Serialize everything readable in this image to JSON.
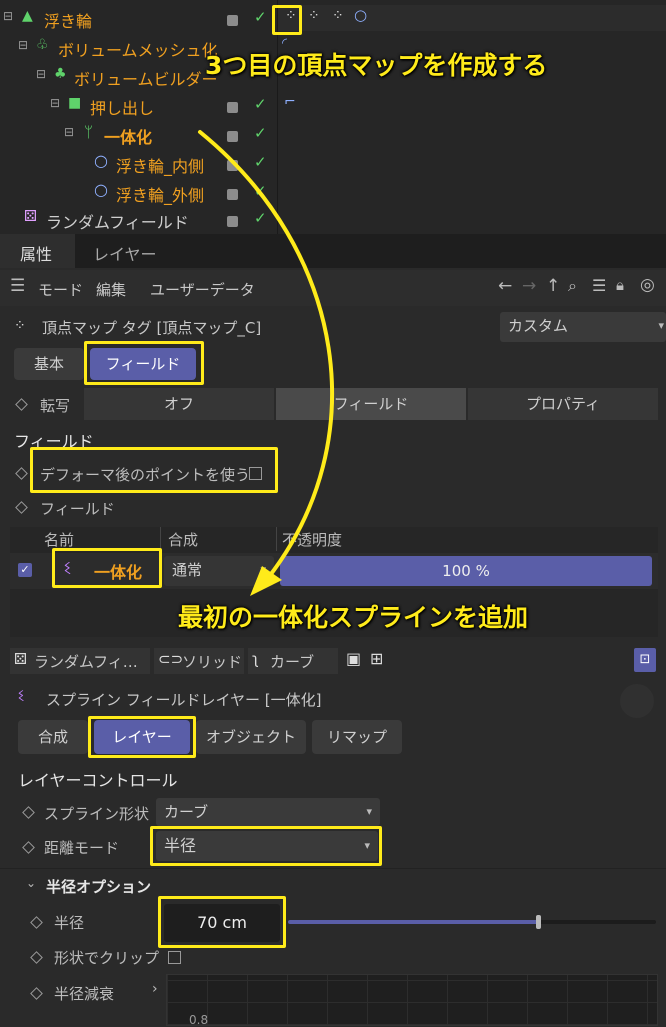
{
  "object_manager": {
    "rows": [
      {
        "name": "浮き輪",
        "color": "orange"
      },
      {
        "name": "ボリュームメッシュ化",
        "color": "orange"
      },
      {
        "name": "ボリュームビルダー",
        "color": "orange"
      },
      {
        "name": "押し出し",
        "color": "orange"
      },
      {
        "name": "一体化",
        "color": "orange"
      },
      {
        "name": "浮き輪_内側",
        "color": "orange"
      },
      {
        "name": "浮き輪_外側",
        "color": "orange"
      },
      {
        "name": "ランダムフィールド",
        "color": "normal"
      }
    ]
  },
  "annotations": {
    "top": "3つ目の頂点マップを作成する",
    "middle": "最初の一体化スプラインを追加"
  },
  "tabs": {
    "attributes": "属性",
    "layers": "レイヤー"
  },
  "menu": {
    "mode": "モード",
    "edit": "編集",
    "user_data": "ユーザーデータ"
  },
  "tag": {
    "title": "頂点マップ タグ [頂点マップ_C]",
    "preset": "カスタム"
  },
  "main_tabs": {
    "basic": "基本",
    "field": "フィールド"
  },
  "transfer": {
    "label": "転写",
    "options": [
      "オフ",
      "フィールド",
      "プロパティ"
    ]
  },
  "field_section": {
    "title": "フィールド",
    "use_deformed": "デフォーマ後のポイントを使う",
    "field_label": "フィールド",
    "columns": {
      "name": "名前",
      "blend": "合成",
      "opacity": "不透明度"
    },
    "layer": {
      "name": "一体化",
      "blend": "通常",
      "opacity_text": "100 %",
      "opacity": 1.0
    }
  },
  "layer_buttons": {
    "random": "ランダムフィ…",
    "solid": "ソリッド",
    "curve": "カーブ"
  },
  "spline_layer": {
    "title": "スプライン フィールドレイヤー [一体化]",
    "tabs": {
      "blend": "合成",
      "layer": "レイヤー",
      "object": "オブジェクト",
      "remap": "リマップ"
    },
    "controls_title": "レイヤーコントロール",
    "spline_shape_label": "スプライン形状",
    "spline_shape_value": "カーブ",
    "distance_mode_label": "距離モード",
    "distance_mode_value": "半径",
    "radius_options_title": "半径オプション",
    "radius_label": "半径",
    "radius_value": "70 cm",
    "radius_slider": 0.68,
    "clip_label": "形状でクリップ",
    "falloff_label": "半径減衰",
    "graph_label": "0.8"
  }
}
